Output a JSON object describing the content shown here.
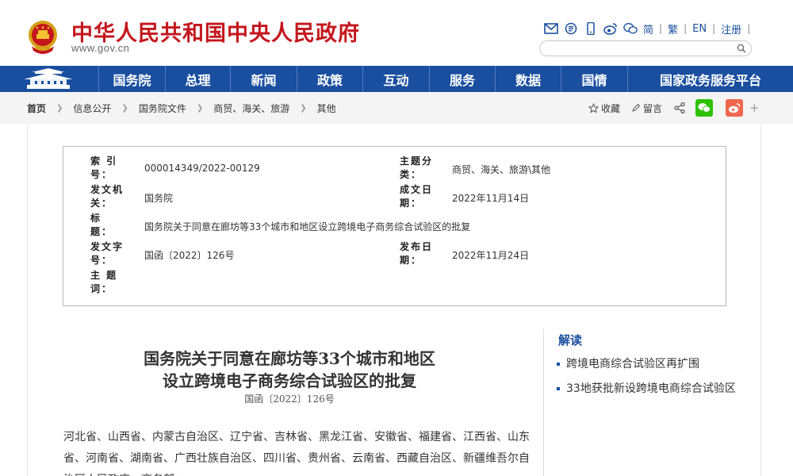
{
  "header": {
    "title": "中华人民共和国中央人民政府",
    "url": "www.gov.cn",
    "langs": [
      "简",
      "繁",
      "EN",
      "注册"
    ],
    "search_placeholder": ""
  },
  "nav": {
    "items": [
      "国务院",
      "总理",
      "新闻",
      "政策",
      "互动",
      "服务",
      "数据",
      "国情",
      "国家政务服务平台"
    ]
  },
  "breadcrumb": {
    "items": [
      "首页",
      "信息公开",
      "国务院文件",
      "商贸、海关、旅游",
      "其他"
    ]
  },
  "share": {
    "favorite": "收藏",
    "comment": "留言"
  },
  "meta": {
    "index_label": "索 引 号：",
    "index_value": "000014349/2022-00129",
    "category_label": "主题分类：",
    "category_value": "商贸、海关、旅游\\其他",
    "issuer_label": "发文机关：",
    "issuer_value": "国务院",
    "written_label": "成文日期：",
    "written_value": "2022年11月14日",
    "title_label": "标　　题：",
    "title_value": "国务院关于同意在廊坊等33个城市和地区设立跨境电子商务综合试验区的批复",
    "docno_label": "发文字号：",
    "docno_value": "国函〔2022〕126号",
    "published_label": "发布日期：",
    "published_value": "2022年11月24日",
    "keywords_label": "主 题 词：",
    "keywords_value": ""
  },
  "article": {
    "title_line1": "国务院关于同意在廊坊等33个城市和地区",
    "title_line2": "设立跨境电子商务综合试验区的批复",
    "doc_number": "国函〔2022〕126号",
    "body": "河北省、山西省、内蒙古自治区、辽宁省、吉林省、黑龙江省、安徽省、福建省、江西省、山东省、河南省、湖南省、广西壮族自治区、四川省、贵州省、云南省、西藏自治区、新疆维吾尔自治区人民政府，商务部："
  },
  "sidebar": {
    "title": "解读",
    "items": [
      "跨境电商综合试验区再扩围",
      "33地获批新设跨境电商综合试验区"
    ]
  },
  "colors": {
    "brand_red": "#c4161c",
    "nav_blue": "#1a4fa0",
    "wechat_green": "#2dc100",
    "weibo_red": "#f0674f"
  },
  "icons": [
    "emblem-icon",
    "mail-icon",
    "rss-icon",
    "mobile-icon",
    "weibo-icon",
    "wechat-icon",
    "search-icon",
    "star-icon",
    "pencil-icon",
    "share-icon",
    "plus-icon"
  ]
}
